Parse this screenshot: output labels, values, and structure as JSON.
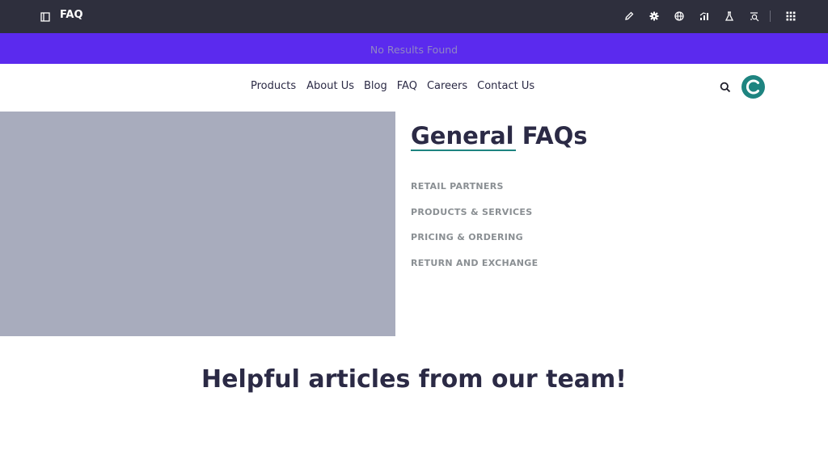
{
  "topbar": {
    "title": "FAQ",
    "icons": [
      "pencil-icon",
      "gear-icon",
      "globe-icon",
      "chart-icon",
      "flask-icon",
      "search-list-icon",
      "apps-grid-icon"
    ]
  },
  "banner": {
    "text": "No Results Found"
  },
  "nav": {
    "links": [
      "Products",
      "About Us",
      "Blog",
      "FAQ",
      "Careers",
      "Contact Us"
    ]
  },
  "avatar": {
    "letter": "C"
  },
  "faq": {
    "title": "General FAQs",
    "categories": [
      "RETAIL PARTNERS",
      "PRODUCTS & SERVICES",
      "PRICING & ORDERING",
      "RETURN AND EXCHANGE"
    ]
  },
  "articles": {
    "heading": "Helpful articles from our team!"
  },
  "colors": {
    "topbar": "#2e2f3d",
    "banner": "#5b2aee",
    "accent": "#1e8480",
    "heading": "#2b2a45",
    "placeholder_image": "#a8acbd"
  }
}
